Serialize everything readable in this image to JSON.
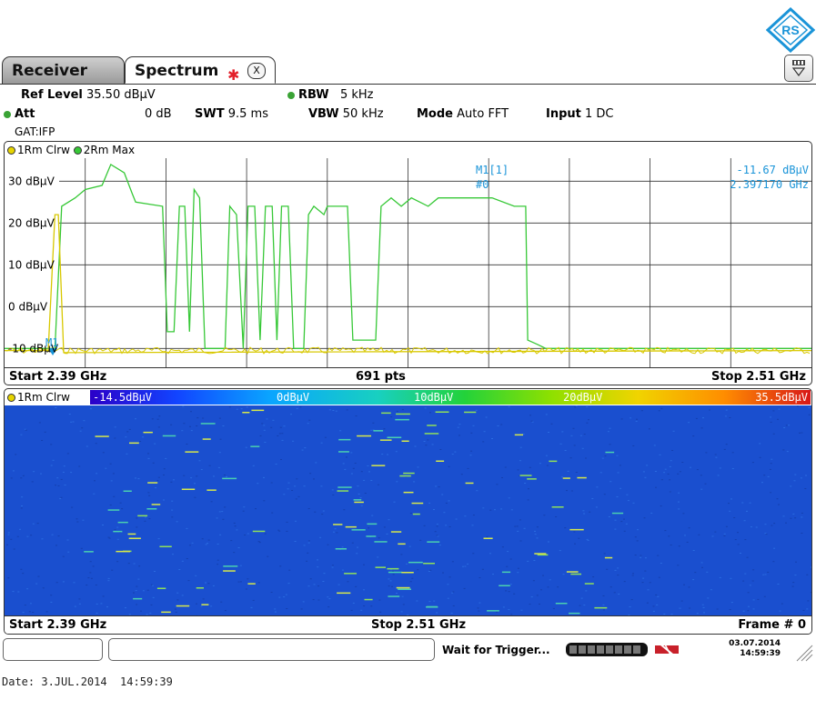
{
  "colors": {
    "green_trace": "#37c837",
    "yellow_trace": "#d8c800",
    "marker": "#1a94d8",
    "waterfall_bg": "#1a4fcf"
  },
  "logo": {
    "text": "RS"
  },
  "tabs": [
    {
      "label": "Receiver",
      "active": false
    },
    {
      "label": "Spectrum",
      "active": true,
      "close_glyph": "X"
    }
  ],
  "header": {
    "ref_level_label": "Ref Level",
    "ref_level_value": "35.50 dBµV",
    "att_label": "Att",
    "att_value": "0 dB",
    "swt_label": "SWT",
    "swt_value": "9.5 ms",
    "rbw_label": "RBW",
    "rbw_value": "5 kHz",
    "vbw_label": "VBW",
    "vbw_value": "50 kHz",
    "mode_label": "Mode",
    "mode_value": "Auto FFT",
    "input_label": "Input",
    "input_value": "1 DC",
    "gate": "GAT:IFP"
  },
  "diagram1": {
    "trace1_label": "1Rm Clrw",
    "trace2_label": "2Rm Max",
    "marker_label": "M1[1]",
    "marker_sub": "#0",
    "marker_level": "-11.67 dBµV",
    "marker_freq": "2.397170 GHz",
    "marker_tag": "M1",
    "start": "Start 2.39 GHz",
    "points": "691 pts",
    "stop": "Stop 2.51 GHz"
  },
  "diagram2": {
    "trace_label": "1Rm Clrw",
    "scale": [
      "-14.5dBµV",
      "0dBµV",
      "10dBµV",
      "20dBµV",
      "35.5dBµV"
    ],
    "start": "Start 2.39 GHz",
    "stop": "Stop 2.51 GHz",
    "frame": "Frame # 0"
  },
  "status": {
    "message": "Wait for Trigger...",
    "date": "03.07.2014",
    "time": "14:59:39"
  },
  "footer": {
    "date_line": "Date: 3.JUL.2014  14:59:39"
  },
  "chart_data": {
    "type": "line",
    "title": "",
    "xlabel": "",
    "ylabel": "",
    "xlim": [
      2.39,
      2.51
    ],
    "ylim": [
      -14.5,
      35.5
    ],
    "y_ticks": [
      {
        "value": 30,
        "label": "30 dBµV"
      },
      {
        "value": 20,
        "label": "20 dBµV"
      },
      {
        "value": 10,
        "label": "10 dBµV"
      },
      {
        "value": 0,
        "label": "0 dBµV"
      },
      {
        "value": -10,
        "label": "-10 dBµV"
      }
    ],
    "grid": true,
    "series": [
      {
        "name": "2Rm Max",
        "color": "#37c837",
        "points": [
          [
            2.39,
            -10
          ],
          [
            2.3975,
            -10
          ],
          [
            2.3985,
            24
          ],
          [
            2.4005,
            26
          ],
          [
            2.402,
            28
          ],
          [
            2.4045,
            29
          ],
          [
            2.4058,
            34
          ],
          [
            2.4078,
            32
          ],
          [
            2.409,
            27
          ],
          [
            2.4095,
            25
          ],
          [
            2.4135,
            24
          ],
          [
            2.4142,
            -6
          ],
          [
            2.4152,
            -6
          ],
          [
            2.416,
            24
          ],
          [
            2.4168,
            24
          ],
          [
            2.4175,
            -6
          ],
          [
            2.4182,
            28
          ],
          [
            2.419,
            26
          ],
          [
            2.4198,
            -10
          ],
          [
            2.4228,
            -10
          ],
          [
            2.4235,
            24
          ],
          [
            2.4245,
            22
          ],
          [
            2.4255,
            -10
          ],
          [
            2.4262,
            24
          ],
          [
            2.4272,
            24
          ],
          [
            2.428,
            -8
          ],
          [
            2.4288,
            24
          ],
          [
            2.4298,
            24
          ],
          [
            2.4305,
            -8
          ],
          [
            2.4312,
            24
          ],
          [
            2.4322,
            24
          ],
          [
            2.433,
            -10
          ],
          [
            2.4345,
            -10
          ],
          [
            2.4352,
            22
          ],
          [
            2.436,
            24
          ],
          [
            2.4375,
            22
          ],
          [
            2.438,
            24
          ],
          [
            2.441,
            24
          ],
          [
            2.4418,
            -8
          ],
          [
            2.4452,
            -8
          ],
          [
            2.446,
            24
          ],
          [
            2.4475,
            26
          ],
          [
            2.449,
            24
          ],
          [
            2.4505,
            26
          ],
          [
            2.453,
            24
          ],
          [
            2.4545,
            26
          ],
          [
            2.458,
            26
          ],
          [
            2.461,
            26
          ],
          [
            2.4625,
            26
          ],
          [
            2.4658,
            24
          ],
          [
            2.4675,
            24
          ],
          [
            2.4678,
            -8
          ],
          [
            2.4692,
            -9
          ],
          [
            2.4705,
            -10
          ],
          [
            2.51,
            -10
          ]
        ]
      },
      {
        "name": "1Rm Clrw",
        "color": "#d8c800",
        "points": [
          [
            2.39,
            -10.5
          ],
          [
            2.3965,
            -10.5
          ],
          [
            2.3975,
            22
          ],
          [
            2.398,
            22
          ],
          [
            2.3988,
            -11
          ],
          [
            2.51,
            -10.5
          ]
        ]
      }
    ],
    "marker": {
      "label": "M1",
      "x": 2.39717,
      "y": -11.67
    }
  }
}
